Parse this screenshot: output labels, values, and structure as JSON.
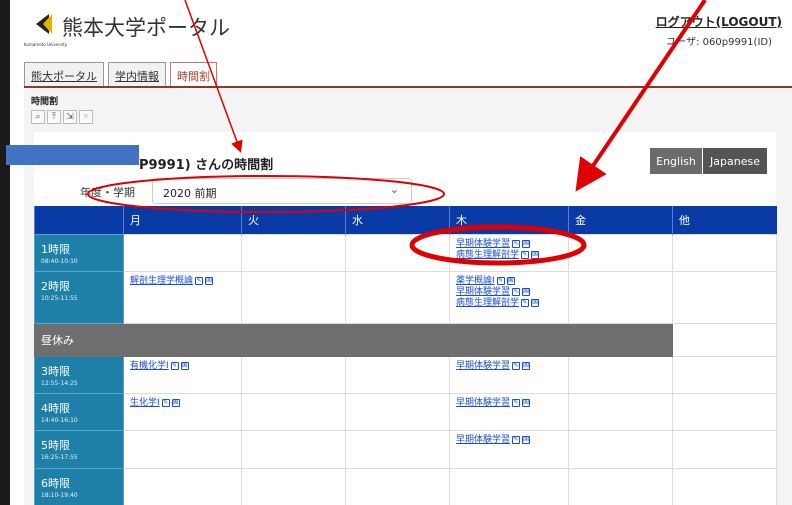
{
  "header": {
    "title": "熊本大学ポータル",
    "subtitle": "Kumamoto University",
    "logout": "ログアウト(LOGOUT)",
    "user": "ユーザ: 060p9991(ID)"
  },
  "tabs": [
    {
      "label": "熊大ポータル"
    },
    {
      "label": "学内情報"
    },
    {
      "label": "時間割"
    }
  ],
  "section": {
    "title": "時間割",
    "heading_suffix": "P9991) さんの時間割"
  },
  "language": {
    "english": "English",
    "japanese": "Japanese"
  },
  "term": {
    "label": "年度・学期",
    "value": "2020 前期"
  },
  "days": [
    "月",
    "火",
    "水",
    "木",
    "金",
    "他"
  ],
  "periods": [
    {
      "name": "1時限",
      "time": "08:40-10:10"
    },
    {
      "name": "2時限",
      "time": "10:25-11:55"
    },
    {
      "name": "3時限",
      "time": "12:55-14:25"
    },
    {
      "name": "4時限",
      "time": "14:40-16:10"
    },
    {
      "name": "5時限",
      "time": "16:25-17:55"
    },
    {
      "name": "6時限",
      "time": "18:10-19:40"
    }
  ],
  "lunch": "昼休み",
  "courses": {
    "p1_thu_1": "早期体験学習",
    "p1_thu_2": "病態生理解剖学",
    "p2_mon_1": "解剖生理学概論",
    "p2_thu_1": "薬学概論I",
    "p2_thu_2": "早期体験学習",
    "p2_thu_3": "病態生理解剖学",
    "p3_mon_1": "有機化学I",
    "p3_thu_1": "早期体験学習",
    "p4_mon_1": "生化学I",
    "p4_thu_1": "早期体験学習",
    "p5_thu_1": "早期体験学習"
  },
  "colors": {
    "table_header": "#0a3aa6",
    "period_cell": "#1e7fa8",
    "lunch_row": "#6e6e6e",
    "annotation": "#e00000",
    "redaction": "#3f73c4"
  },
  "icons": [
    "zoom-icon",
    "up-arrow-icon",
    "export-icon",
    "close-icon",
    "syllabus-icon",
    "national-icon"
  ]
}
